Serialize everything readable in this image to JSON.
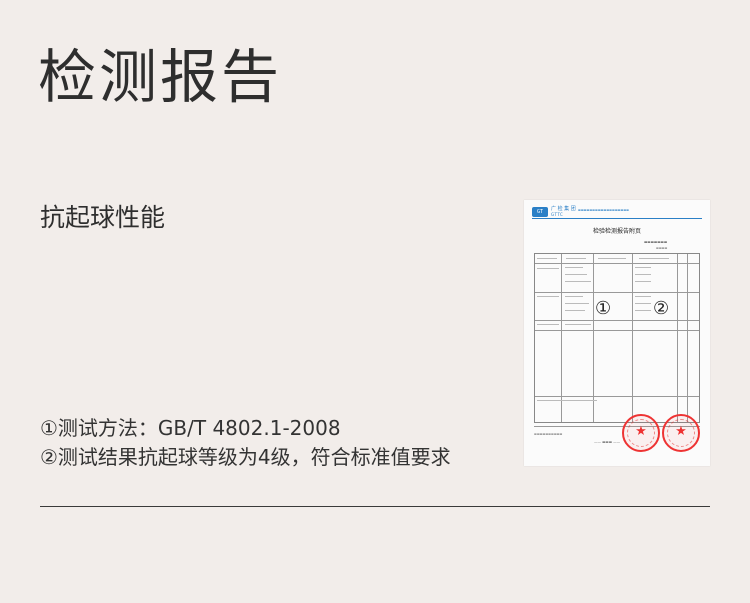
{
  "page": {
    "title": "检测报告",
    "subtitle": "抗起球性能",
    "notes": [
      "①测试方法：GB/T 4802.1-2008",
      "②测试结果抗起球等级为4级，符合标准值要求"
    ]
  },
  "report_image": {
    "title": "检验检测报告附页",
    "callout_1": "①",
    "callout_2": "②"
  }
}
